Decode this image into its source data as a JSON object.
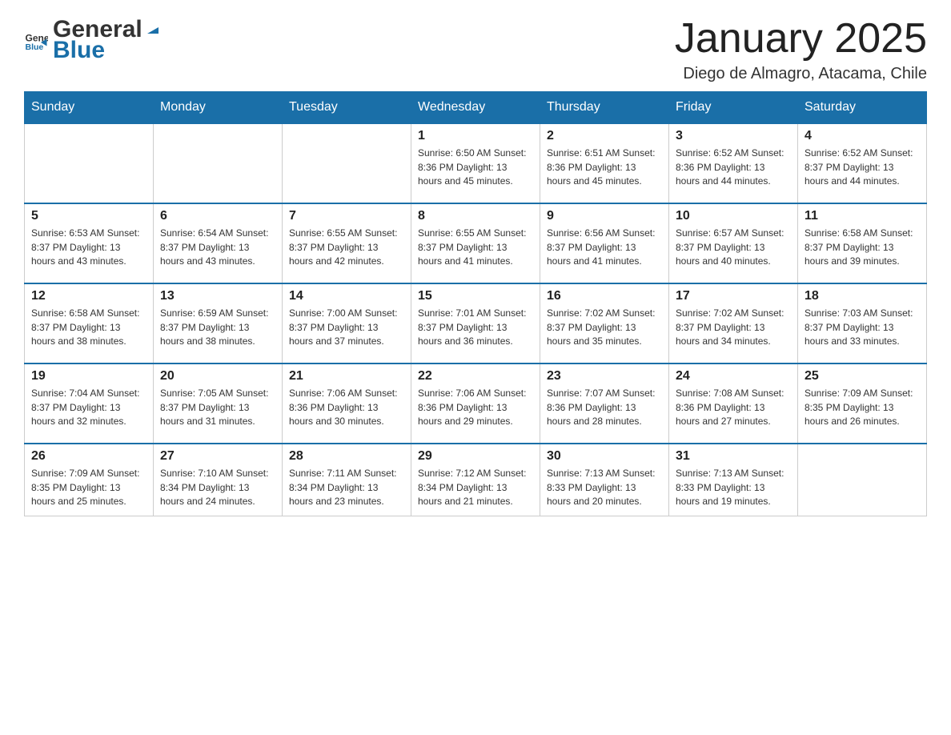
{
  "header": {
    "logo_general": "General",
    "logo_blue": "Blue",
    "month_year": "January 2025",
    "location": "Diego de Almagro, Atacama, Chile"
  },
  "days_of_week": [
    "Sunday",
    "Monday",
    "Tuesday",
    "Wednesday",
    "Thursday",
    "Friday",
    "Saturday"
  ],
  "weeks": [
    [
      {
        "day": "",
        "info": ""
      },
      {
        "day": "",
        "info": ""
      },
      {
        "day": "",
        "info": ""
      },
      {
        "day": "1",
        "info": "Sunrise: 6:50 AM\nSunset: 8:36 PM\nDaylight: 13 hours\nand 45 minutes."
      },
      {
        "day": "2",
        "info": "Sunrise: 6:51 AM\nSunset: 8:36 PM\nDaylight: 13 hours\nand 45 minutes."
      },
      {
        "day": "3",
        "info": "Sunrise: 6:52 AM\nSunset: 8:36 PM\nDaylight: 13 hours\nand 44 minutes."
      },
      {
        "day": "4",
        "info": "Sunrise: 6:52 AM\nSunset: 8:37 PM\nDaylight: 13 hours\nand 44 minutes."
      }
    ],
    [
      {
        "day": "5",
        "info": "Sunrise: 6:53 AM\nSunset: 8:37 PM\nDaylight: 13 hours\nand 43 minutes."
      },
      {
        "day": "6",
        "info": "Sunrise: 6:54 AM\nSunset: 8:37 PM\nDaylight: 13 hours\nand 43 minutes."
      },
      {
        "day": "7",
        "info": "Sunrise: 6:55 AM\nSunset: 8:37 PM\nDaylight: 13 hours\nand 42 minutes."
      },
      {
        "day": "8",
        "info": "Sunrise: 6:55 AM\nSunset: 8:37 PM\nDaylight: 13 hours\nand 41 minutes."
      },
      {
        "day": "9",
        "info": "Sunrise: 6:56 AM\nSunset: 8:37 PM\nDaylight: 13 hours\nand 41 minutes."
      },
      {
        "day": "10",
        "info": "Sunrise: 6:57 AM\nSunset: 8:37 PM\nDaylight: 13 hours\nand 40 minutes."
      },
      {
        "day": "11",
        "info": "Sunrise: 6:58 AM\nSunset: 8:37 PM\nDaylight: 13 hours\nand 39 minutes."
      }
    ],
    [
      {
        "day": "12",
        "info": "Sunrise: 6:58 AM\nSunset: 8:37 PM\nDaylight: 13 hours\nand 38 minutes."
      },
      {
        "day": "13",
        "info": "Sunrise: 6:59 AM\nSunset: 8:37 PM\nDaylight: 13 hours\nand 38 minutes."
      },
      {
        "day": "14",
        "info": "Sunrise: 7:00 AM\nSunset: 8:37 PM\nDaylight: 13 hours\nand 37 minutes."
      },
      {
        "day": "15",
        "info": "Sunrise: 7:01 AM\nSunset: 8:37 PM\nDaylight: 13 hours\nand 36 minutes."
      },
      {
        "day": "16",
        "info": "Sunrise: 7:02 AM\nSunset: 8:37 PM\nDaylight: 13 hours\nand 35 minutes."
      },
      {
        "day": "17",
        "info": "Sunrise: 7:02 AM\nSunset: 8:37 PM\nDaylight: 13 hours\nand 34 minutes."
      },
      {
        "day": "18",
        "info": "Sunrise: 7:03 AM\nSunset: 8:37 PM\nDaylight: 13 hours\nand 33 minutes."
      }
    ],
    [
      {
        "day": "19",
        "info": "Sunrise: 7:04 AM\nSunset: 8:37 PM\nDaylight: 13 hours\nand 32 minutes."
      },
      {
        "day": "20",
        "info": "Sunrise: 7:05 AM\nSunset: 8:37 PM\nDaylight: 13 hours\nand 31 minutes."
      },
      {
        "day": "21",
        "info": "Sunrise: 7:06 AM\nSunset: 8:36 PM\nDaylight: 13 hours\nand 30 minutes."
      },
      {
        "day": "22",
        "info": "Sunrise: 7:06 AM\nSunset: 8:36 PM\nDaylight: 13 hours\nand 29 minutes."
      },
      {
        "day": "23",
        "info": "Sunrise: 7:07 AM\nSunset: 8:36 PM\nDaylight: 13 hours\nand 28 minutes."
      },
      {
        "day": "24",
        "info": "Sunrise: 7:08 AM\nSunset: 8:36 PM\nDaylight: 13 hours\nand 27 minutes."
      },
      {
        "day": "25",
        "info": "Sunrise: 7:09 AM\nSunset: 8:35 PM\nDaylight: 13 hours\nand 26 minutes."
      }
    ],
    [
      {
        "day": "26",
        "info": "Sunrise: 7:09 AM\nSunset: 8:35 PM\nDaylight: 13 hours\nand 25 minutes."
      },
      {
        "day": "27",
        "info": "Sunrise: 7:10 AM\nSunset: 8:34 PM\nDaylight: 13 hours\nand 24 minutes."
      },
      {
        "day": "28",
        "info": "Sunrise: 7:11 AM\nSunset: 8:34 PM\nDaylight: 13 hours\nand 23 minutes."
      },
      {
        "day": "29",
        "info": "Sunrise: 7:12 AM\nSunset: 8:34 PM\nDaylight: 13 hours\nand 21 minutes."
      },
      {
        "day": "30",
        "info": "Sunrise: 7:13 AM\nSunset: 8:33 PM\nDaylight: 13 hours\nand 20 minutes."
      },
      {
        "day": "31",
        "info": "Sunrise: 7:13 AM\nSunset: 8:33 PM\nDaylight: 13 hours\nand 19 minutes."
      },
      {
        "day": "",
        "info": ""
      }
    ]
  ]
}
